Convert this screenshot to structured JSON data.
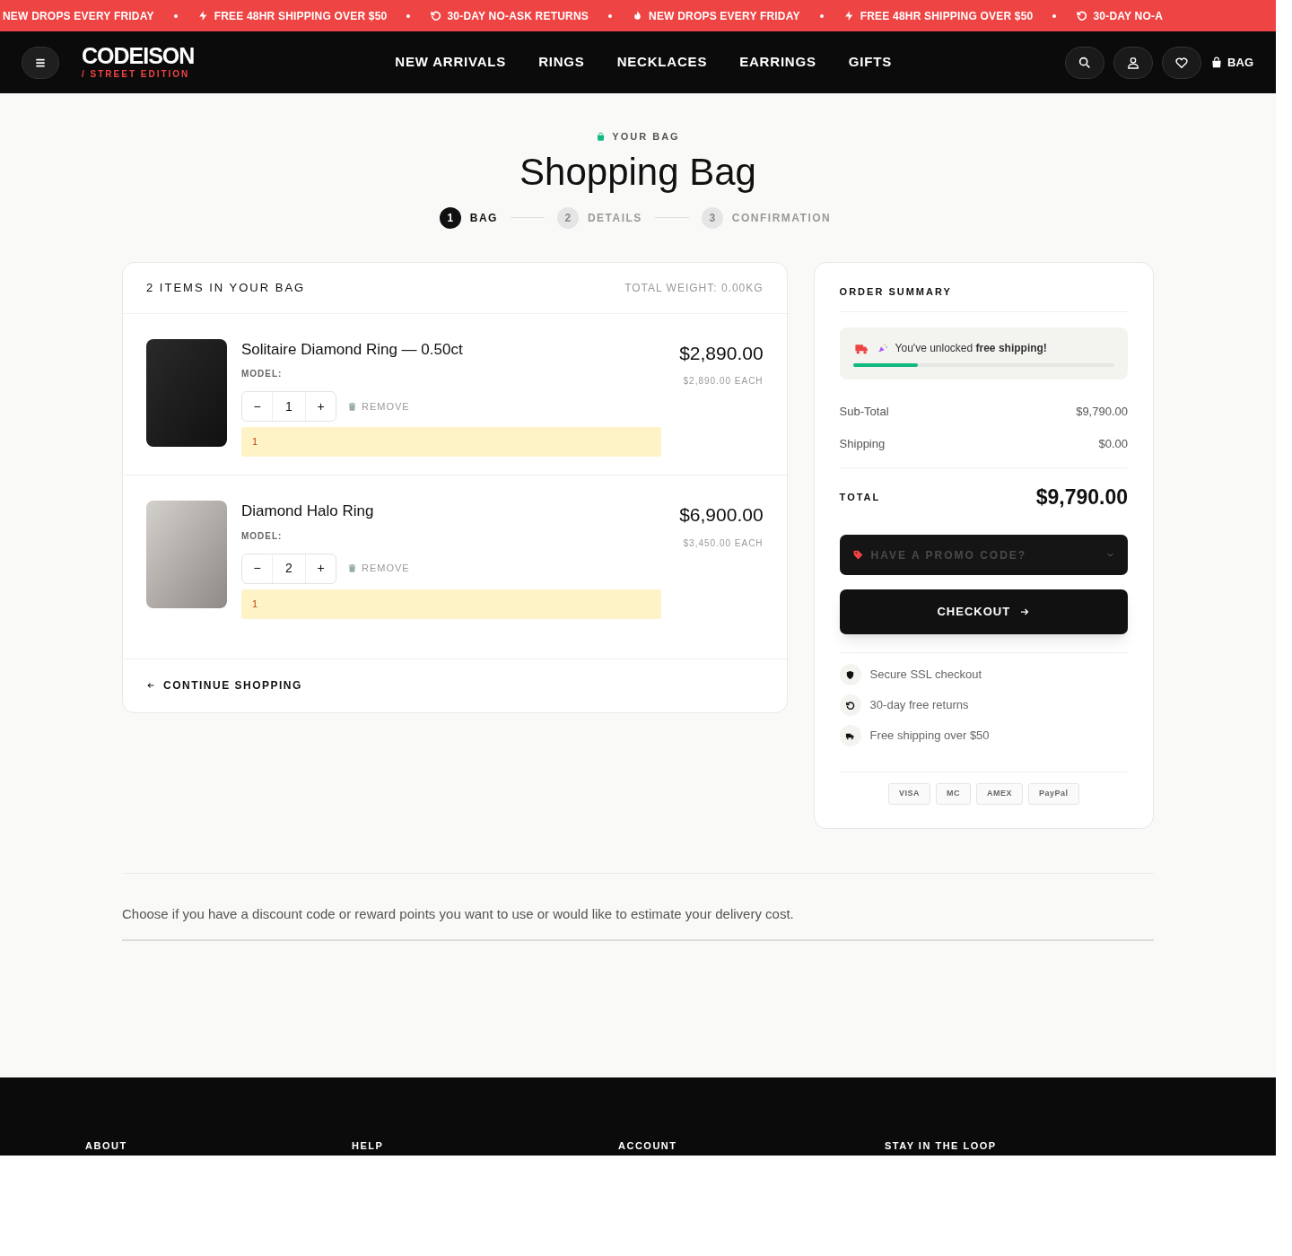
{
  "ticker": [
    {
      "kind": "plain",
      "text": "NEW DROPS EVERY FRIDAY"
    },
    {
      "kind": "bolt",
      "text": "FREE 48HR SHIPPING OVER $50"
    },
    {
      "kind": "return",
      "text": "30-DAY NO-ASK RETURNS"
    },
    {
      "kind": "flame",
      "text": "NEW DROPS EVERY FRIDAY"
    },
    {
      "kind": "bolt",
      "text": "FREE 48HR SHIPPING OVER $50"
    },
    {
      "kind": "return",
      "text": "30-DAY NO-A"
    }
  ],
  "header": {
    "logo": "CODEISON",
    "tagline": "/ STREET EDITION",
    "nav": [
      "NEW ARRIVALS",
      "RINGS",
      "NECKLACES",
      "EARRINGS",
      "GIFTS"
    ],
    "bag_label": "BAG"
  },
  "page": {
    "eyebrow": "YOUR BAG",
    "title": "Shopping Bag"
  },
  "steps": [
    {
      "number": "1",
      "label": "BAG",
      "selected": true
    },
    {
      "number": "2",
      "label": "DETAILS",
      "selected": false
    },
    {
      "number": "3",
      "label": "CONFIRMATION",
      "selected": false
    }
  ],
  "bag": {
    "heading": "2 ITEMS IN YOUR BAG",
    "weight": "TOTAL WEIGHT: 0.00KG",
    "items": [
      {
        "name": "Solitaire Diamond Ring — 0.50ct",
        "model": "MODEL:",
        "quantity": "1",
        "remove": "REMOVE",
        "notice": "1",
        "price": "$2,890.00",
        "each": "$2,890.00 EACH"
      },
      {
        "name": "Diamond Halo Ring",
        "model": "MODEL:",
        "quantity": "2",
        "remove": "REMOVE",
        "notice": "1",
        "price": "$6,900.00",
        "each": "$3,450.00 EACH"
      }
    ],
    "stepper": {
      "minus": "−",
      "plus": "+"
    },
    "continue": "CONTINUE SHOPPING"
  },
  "summary": {
    "title": "ORDER SUMMARY",
    "shipping_message": "You've unlocked **free shipping!**",
    "level": 0.25,
    "lines": [
      {
        "label": "Sub-Total",
        "value": "$9,790.00"
      },
      {
        "label": "Shipping",
        "value": "$0.00"
      }
    ],
    "total_label": "TOTAL",
    "total": "$9,790.00",
    "promo": "HAVE A PROMO CODE?",
    "checkout": "CHECKOUT",
    "assurances": [
      {
        "kind": "shield",
        "text": "Secure SSL checkout"
      },
      {
        "kind": "return",
        "text": "30-day free returns"
      },
      {
        "kind": "truck",
        "text": "Free shipping over $50"
      }
    ],
    "payments": [
      "VISA",
      "MC",
      "AMEX",
      "PayPal"
    ]
  },
  "note": "Choose if you have a discount code or reward points you want to use or would like to estimate your delivery cost.",
  "footer": {
    "headings": [
      "ABOUT",
      "HELP",
      "ACCOUNT",
      "STAY IN THE LOOP"
    ]
  }
}
